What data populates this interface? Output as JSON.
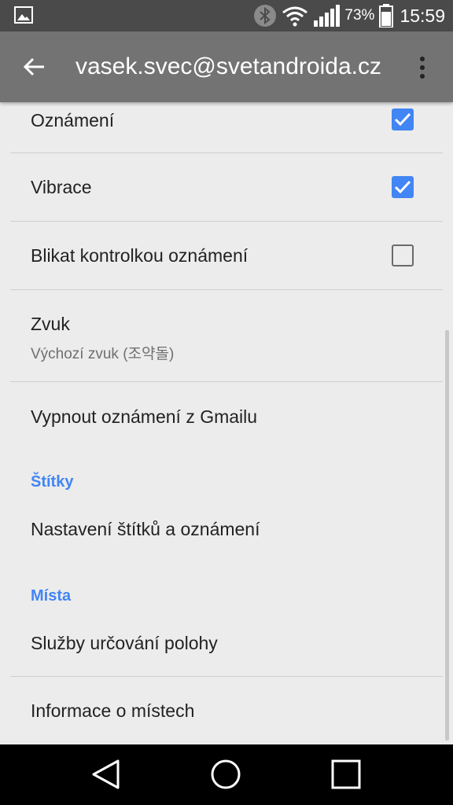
{
  "status_bar": {
    "battery_percent": "73%",
    "time": "15:59",
    "icons": [
      "gallery-icon",
      "bluetooth-icon",
      "wifi-icon",
      "signal-icon",
      "battery-icon"
    ]
  },
  "app_bar": {
    "title": "vasek.svec@svetandroida.cz",
    "icons": [
      "back-arrow-icon",
      "more-vert-icon"
    ]
  },
  "settings": {
    "notifications": {
      "label": "Oznámení",
      "checked": true
    },
    "vibration": {
      "label": "Vibrace",
      "checked": true
    },
    "blink_led": {
      "label": "Blikat kontrolkou oznámení",
      "checked": false
    },
    "sound": {
      "label": "Zvuk",
      "value": "Výchozí zvuk (조약돌)"
    },
    "disable_gmail": {
      "label": "Vypnout oznámení z Gmailu"
    }
  },
  "labels_section": {
    "header": "Štítky",
    "label_settings": "Nastavení štítků a oznámení"
  },
  "places_section": {
    "header": "Místa",
    "location_services": "Služby určování polohy",
    "places_info": "Informace o místech"
  },
  "nav_bar": {
    "icons": [
      "back-triangle-icon",
      "home-circle-icon",
      "recents-square-icon"
    ]
  },
  "colors": {
    "accent": "#4285f4",
    "app_bar": "#737373",
    "status_bar": "#4a4a4a",
    "background": "#ececec"
  }
}
